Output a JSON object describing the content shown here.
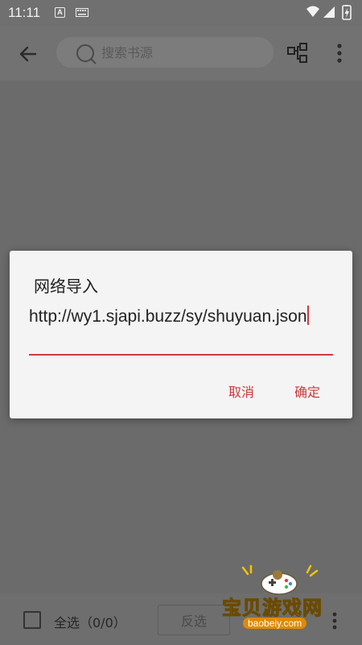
{
  "status_bar": {
    "time": "11:11",
    "icons": [
      "a-notification-icon",
      "keyboard-icon",
      "wifi-icon",
      "signal-icon",
      "battery-icon"
    ]
  },
  "toolbar": {
    "search_placeholder": "搜索书源",
    "icons": [
      "back-arrow-icon",
      "search-icon",
      "group-icon",
      "more-vert-icon"
    ]
  },
  "dialog": {
    "title": "网络导入",
    "url_value": "http://wy1.sjapi.buzz/sy/shuyuan.json",
    "cancel_label": "取消",
    "ok_label": "确定",
    "accent_color": "#c9393a"
  },
  "bottom_bar": {
    "select_all_label": "全选（0/0）",
    "invert_label": "反选"
  },
  "watermark": {
    "title": "宝贝游戏网",
    "url": "baobeiy.com"
  }
}
